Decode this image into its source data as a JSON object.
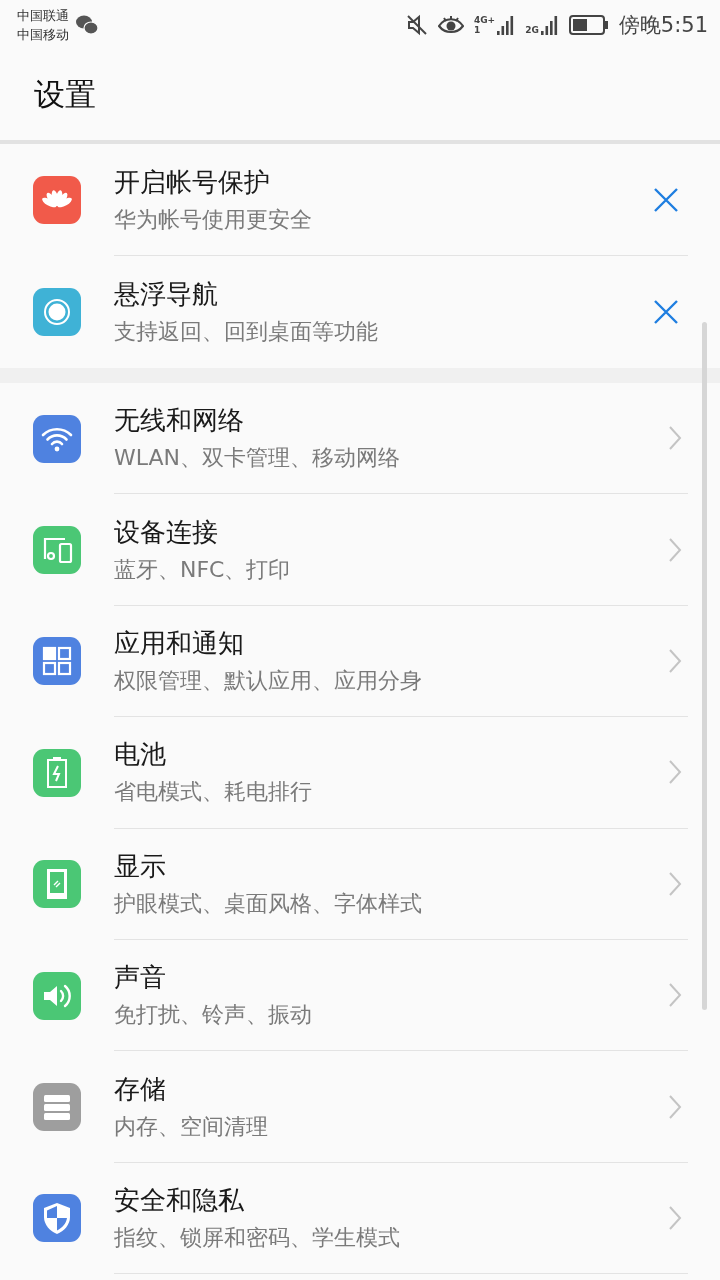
{
  "status_bar": {
    "carriers": [
      "中国联通",
      "中国移动"
    ],
    "signals": [
      {
        "label": "4G+",
        "sub": "1"
      },
      {
        "label": "2G"
      }
    ],
    "time": "傍晚5:51"
  },
  "header": {
    "title": "设置"
  },
  "suggestions": [
    {
      "kind": "petals",
      "color": "#f15a4a",
      "title": "开启帐号保护",
      "subtitle": "华为帐号使用更安全"
    },
    {
      "kind": "dock",
      "color": "#3fb2d6",
      "title": "悬浮导航",
      "subtitle": "支持返回、回到桌面等功能"
    }
  ],
  "settings": [
    {
      "kind": "wifi",
      "color": "#4f82e0",
      "title": "无线和网络",
      "subtitle": "WLAN、双卡管理、移动网络"
    },
    {
      "kind": "devices",
      "color": "#4bc775",
      "title": "设备连接",
      "subtitle": "蓝牙、NFC、打印"
    },
    {
      "kind": "apps",
      "color": "#4f82e0",
      "title": "应用和通知",
      "subtitle": "权限管理、默认应用、应用分身"
    },
    {
      "kind": "battery",
      "color": "#4bc775",
      "title": "电池",
      "subtitle": "省电模式、耗电排行"
    },
    {
      "kind": "display",
      "color": "#4bc775",
      "title": "显示",
      "subtitle": "护眼模式、桌面风格、字体样式"
    },
    {
      "kind": "sound",
      "color": "#4bc775",
      "title": "声音",
      "subtitle": "免打扰、铃声、振动"
    },
    {
      "kind": "storage",
      "color": "#9e9e9e",
      "title": "存储",
      "subtitle": "内存、空间清理"
    },
    {
      "kind": "shield",
      "color": "#4f82e0",
      "title": "安全和隐私",
      "subtitle": "指纹、锁屏和密码、学生模式"
    }
  ]
}
